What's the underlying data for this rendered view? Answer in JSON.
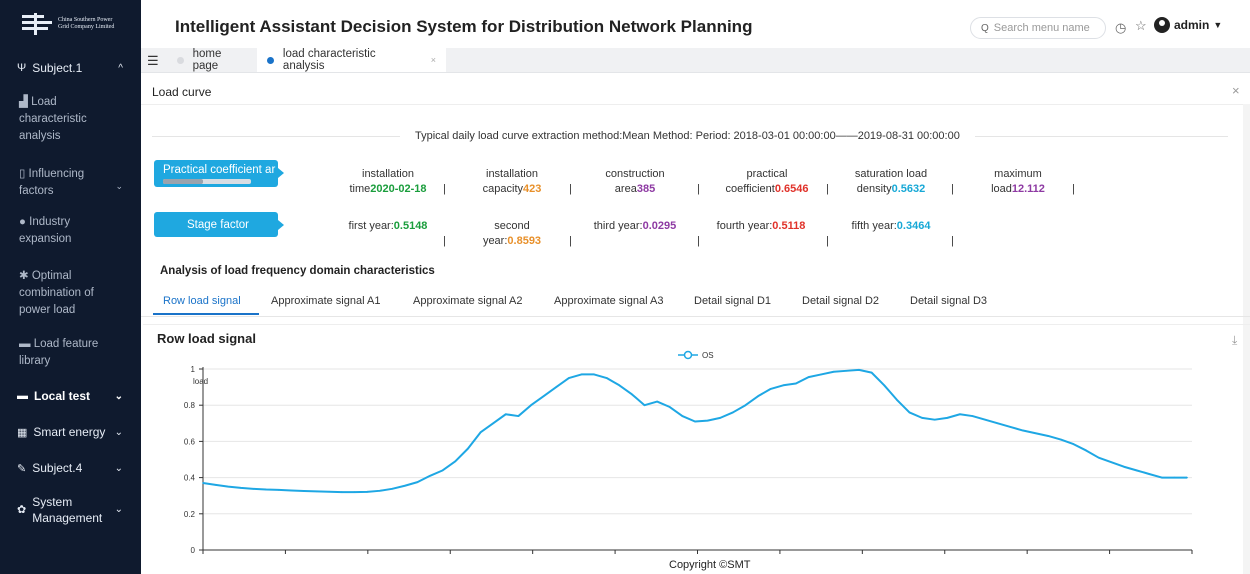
{
  "header": {
    "logo_text": [
      "China Southern Power",
      "Grid Company Limited"
    ],
    "title": "Intelligent Assistant Decision System for Distribution Network Planning",
    "search_placeholder": "Search menu name",
    "user": "admin"
  },
  "sidebar": {
    "subject1": "Subject.1",
    "items": [
      {
        "icon": "bar-chart-icon",
        "label": "Load characteristic analysis"
      },
      {
        "icon": "document-icon",
        "label": "Influencing factors"
      },
      {
        "icon": "circle-icon",
        "label": "Industry expansion"
      },
      {
        "icon": "tools-icon",
        "label": "Optimal combination of power load"
      },
      {
        "icon": "card-icon",
        "label": "Load feature library"
      }
    ],
    "groups": [
      {
        "icon": "card-icon",
        "label": "Local test"
      },
      {
        "icon": "grid-icon",
        "label": "Smart energy"
      },
      {
        "icon": "pen-icon",
        "label": "Subject.4"
      },
      {
        "icon": "gear-icon",
        "label": "System Management"
      }
    ]
  },
  "tabs": [
    {
      "label": "home page",
      "active": false
    },
    {
      "label": "load characteristic analysis",
      "active": true
    }
  ],
  "panel": {
    "title": "Load curve",
    "method": "Typical daily load curve extraction method:Mean Method:  Period:  2018-03-01 00:00:00——2019-08-31 00:00:00",
    "practical_pill": "Practical coefficient ar",
    "practical_progress": 0.45,
    "stage_pill": "Stage factor",
    "stats": [
      {
        "line1": "installation",
        "line2": "time",
        "value": "2020-02-18",
        "color": "#1a9d3c"
      },
      {
        "line1": "installation",
        "line2": "capacity",
        "value": "423",
        "color": "#e8902a"
      },
      {
        "line1": "construction",
        "line2": "area",
        "value": "385",
        "color": "#8e3aa3"
      },
      {
        "line1": "practical",
        "line2": "coefficient",
        "value": "0.6546",
        "color": "#e0322a"
      },
      {
        "line1": "saturation load",
        "line2": "density",
        "value": "0.5632",
        "color": "#17a8d6"
      },
      {
        "line1": "maximum",
        "line2": "load",
        "value": "12.112",
        "color": "#8e3aa3"
      }
    ],
    "stage": [
      {
        "line1": "",
        "line2": "first year:",
        "value": "0.5148",
        "color": "#1a9d3c"
      },
      {
        "line1": "second",
        "line2": "year:",
        "value": "0.8593",
        "color": "#e8902a"
      },
      {
        "line1": "",
        "line2": "third year:",
        "value": "0.0295",
        "color": "#8e3aa3"
      },
      {
        "line1": "",
        "line2": "fourth year:",
        "value": "0.5118",
        "color": "#e0322a"
      },
      {
        "line1": "",
        "line2": "fifth year:",
        "value": "0.3464",
        "color": "#17a8d6"
      }
    ],
    "section_title": "Analysis of load frequency domain characteristics",
    "signal_tabs": [
      "Row load signal",
      "Approximate signal A1",
      "Approximate signal A2",
      "Approximate signal A3",
      "Detail signal D1",
      "Detail signal D2",
      "Detail signal D3"
    ],
    "chart_heading": "Row load signal"
  },
  "footer": "Copyright ©SMT",
  "chart_data": {
    "type": "line",
    "title": "Row load signal",
    "ylabel": "load",
    "xlabel": "",
    "ylim": [
      0,
      1
    ],
    "yticks": [
      "0",
      "0.2",
      "0.4",
      "0.6",
      "0.8",
      "1"
    ],
    "grid": true,
    "legend": "top-center",
    "series": [
      {
        "name": "OS",
        "color": "#1ea7e4",
        "values": [
          0.37,
          0.36,
          0.35,
          0.343,
          0.338,
          0.334,
          0.332,
          0.329,
          0.326,
          0.324,
          0.322,
          0.32,
          0.32,
          0.321,
          0.327,
          0.338,
          0.355,
          0.375,
          0.41,
          0.44,
          0.49,
          0.56,
          0.65,
          0.7,
          0.75,
          0.74,
          0.8,
          0.85,
          0.9,
          0.95,
          0.97,
          0.97,
          0.95,
          0.91,
          0.86,
          0.8,
          0.82,
          0.79,
          0.74,
          0.71,
          0.715,
          0.73,
          0.76,
          0.8,
          0.85,
          0.89,
          0.91,
          0.92,
          0.955,
          0.97,
          0.985,
          0.99,
          0.995,
          0.98,
          0.91,
          0.83,
          0.76,
          0.73,
          0.72,
          0.73,
          0.75,
          0.74,
          0.72,
          0.7,
          0.68,
          0.66,
          0.645,
          0.63,
          0.61,
          0.585,
          0.55,
          0.51,
          0.485,
          0.46,
          0.44,
          0.42,
          0.4,
          0.4,
          0.4
        ]
      }
    ]
  }
}
